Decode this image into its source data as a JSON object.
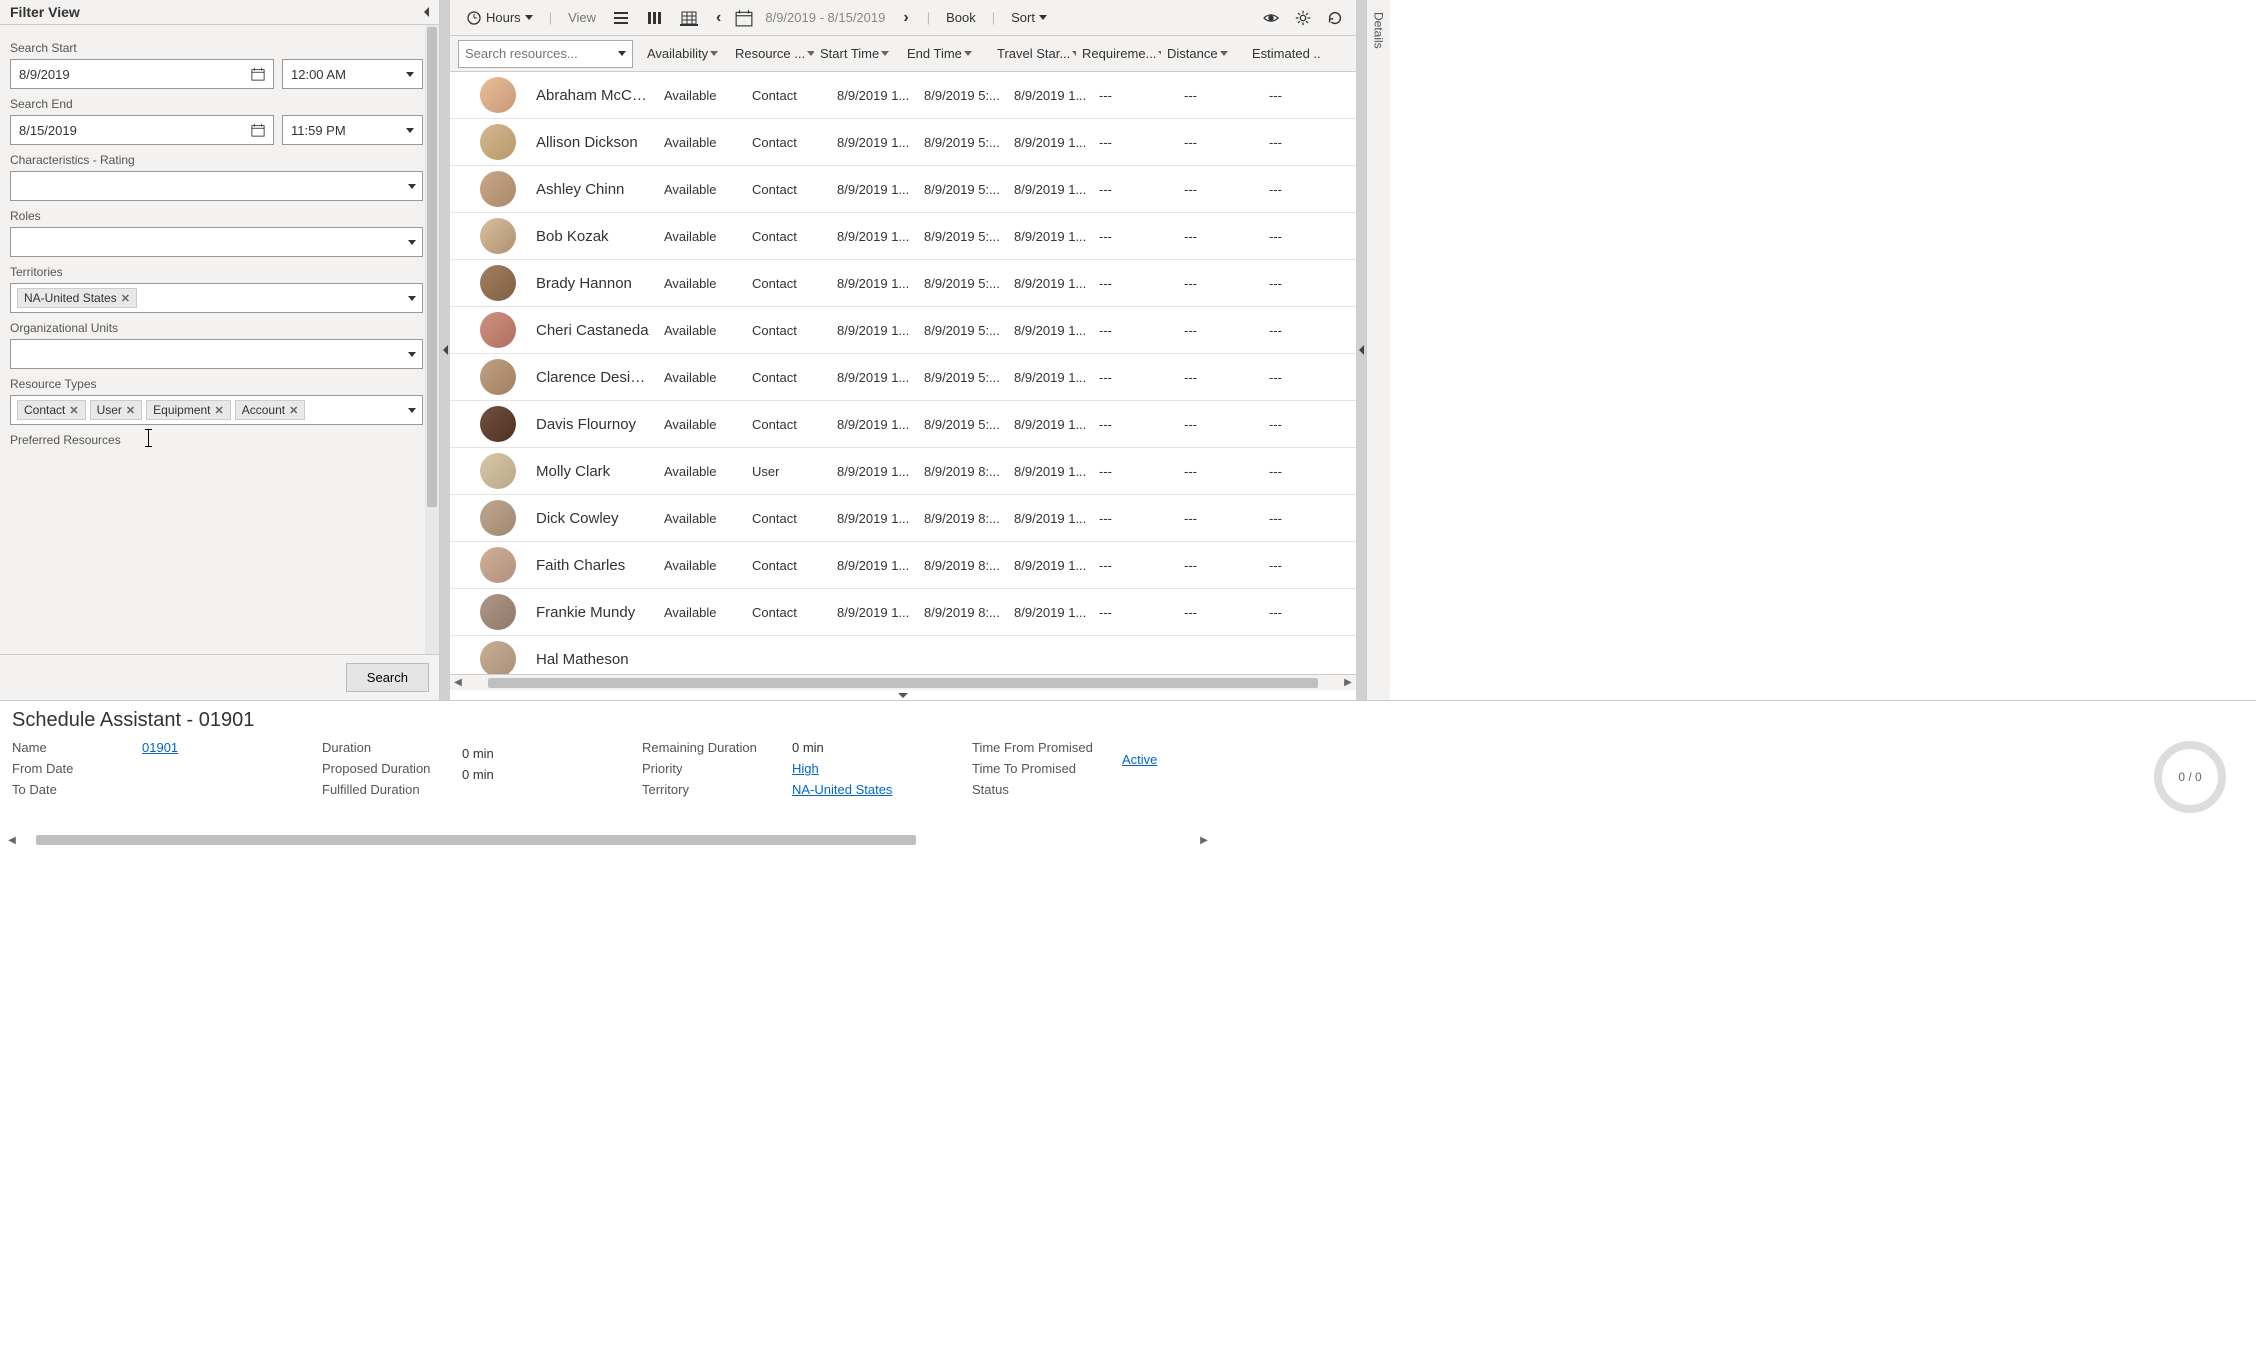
{
  "filter": {
    "title": "Filter View",
    "searchStartLabel": "Search Start",
    "searchStartDate": "8/9/2019",
    "searchStartTime": "12:00 AM",
    "searchEndLabel": "Search End",
    "searchEndDate": "8/15/2019",
    "searchEndTime": "11:59 PM",
    "characteristicsLabel": "Characteristics - Rating",
    "rolesLabel": "Roles",
    "territoriesLabel": "Territories",
    "territories": [
      "NA-United States"
    ],
    "orgUnitsLabel": "Organizational Units",
    "resourceTypesLabel": "Resource Types",
    "resourceTypes": [
      "Contact",
      "User",
      "Equipment",
      "Account"
    ],
    "preferredLabel": "Preferred Resources",
    "searchButton": "Search"
  },
  "toolbar": {
    "hoursLabel": "Hours",
    "viewLabel": "View",
    "dateRange": "8/9/2019 - 8/15/2019",
    "bookLabel": "Book",
    "sortLabel": "Sort"
  },
  "grid": {
    "searchPlaceholder": "Search resources...",
    "columns": [
      "Availability",
      "Resource ...",
      "Start Time",
      "End Time",
      "Travel Star...",
      "Requireme...",
      "Distance",
      "Estimated ..."
    ],
    "rows": [
      {
        "name": "Abraham McCor...",
        "avail": "Available",
        "res": "Contact",
        "start": "8/9/2019 1...",
        "end": "8/9/2019 5:...",
        "trav": "8/9/2019 1...",
        "req": "---",
        "dist": "---",
        "est": "---"
      },
      {
        "name": "Allison Dickson",
        "avail": "Available",
        "res": "Contact",
        "start": "8/9/2019 1...",
        "end": "8/9/2019 5:...",
        "trav": "8/9/2019 1...",
        "req": "---",
        "dist": "---",
        "est": "---"
      },
      {
        "name": "Ashley Chinn",
        "avail": "Available",
        "res": "Contact",
        "start": "8/9/2019 1...",
        "end": "8/9/2019 5:...",
        "trav": "8/9/2019 1...",
        "req": "---",
        "dist": "---",
        "est": "---"
      },
      {
        "name": "Bob Kozak",
        "avail": "Available",
        "res": "Contact",
        "start": "8/9/2019 1...",
        "end": "8/9/2019 5:...",
        "trav": "8/9/2019 1...",
        "req": "---",
        "dist": "---",
        "est": "---"
      },
      {
        "name": "Brady Hannon",
        "avail": "Available",
        "res": "Contact",
        "start": "8/9/2019 1...",
        "end": "8/9/2019 5:...",
        "trav": "8/9/2019 1...",
        "req": "---",
        "dist": "---",
        "est": "---"
      },
      {
        "name": "Cheri Castaneda",
        "avail": "Available",
        "res": "Contact",
        "start": "8/9/2019 1...",
        "end": "8/9/2019 5:...",
        "trav": "8/9/2019 1...",
        "req": "---",
        "dist": "---",
        "est": "---"
      },
      {
        "name": "Clarence Desimo...",
        "avail": "Available",
        "res": "Contact",
        "start": "8/9/2019 1...",
        "end": "8/9/2019 5:...",
        "trav": "8/9/2019 1...",
        "req": "---",
        "dist": "---",
        "est": "---"
      },
      {
        "name": "Davis Flournoy",
        "avail": "Available",
        "res": "Contact",
        "start": "8/9/2019 1...",
        "end": "8/9/2019 5:...",
        "trav": "8/9/2019 1...",
        "req": "---",
        "dist": "---",
        "est": "---"
      },
      {
        "name": "Molly Clark",
        "avail": "Available",
        "res": "User",
        "start": "8/9/2019 1...",
        "end": "8/9/2019 8:...",
        "trav": "8/9/2019 1...",
        "req": "---",
        "dist": "---",
        "est": "---"
      },
      {
        "name": "Dick Cowley",
        "avail": "Available",
        "res": "Contact",
        "start": "8/9/2019 1...",
        "end": "8/9/2019 8:...",
        "trav": "8/9/2019 1...",
        "req": "---",
        "dist": "---",
        "est": "---"
      },
      {
        "name": "Faith Charles",
        "avail": "Available",
        "res": "Contact",
        "start": "8/9/2019 1...",
        "end": "8/9/2019 8:...",
        "trav": "8/9/2019 1...",
        "req": "---",
        "dist": "---",
        "est": "---"
      },
      {
        "name": "Frankie Mundy",
        "avail": "Available",
        "res": "Contact",
        "start": "8/9/2019 1...",
        "end": "8/9/2019 8:...",
        "trav": "8/9/2019 1...",
        "req": "---",
        "dist": "---",
        "est": "---"
      },
      {
        "name": "Hal Matheson",
        "avail": "",
        "res": "",
        "start": "",
        "end": "",
        "trav": "",
        "req": "",
        "dist": "",
        "est": ""
      }
    ]
  },
  "details": {
    "label": "Details"
  },
  "bottom": {
    "title": "Schedule Assistant - 01901",
    "nameLabel": "Name",
    "nameValue": "01901",
    "fromLabel": "From Date",
    "fromValue": "",
    "toLabel": "To Date",
    "toValue": "",
    "durationLabel": "Duration",
    "durationValue": "",
    "proposedLabel": "Proposed Duration",
    "proposedValue": "0 min",
    "fulfilledLabel": "Fulfilled Duration",
    "fulfilledValue": "0 min",
    "remainingLabel": "Remaining Duration",
    "remainingValue": "0 min",
    "priorityLabel": "Priority",
    "priorityValue": "High",
    "territoryLabel": "Territory",
    "territoryValue": "NA-United States",
    "timeFromLabel": "Time From Promised",
    "timeFromValue": "",
    "timeToLabel": "Time To Promised",
    "timeToValue": "",
    "statusLabel": "Status",
    "statusValue": "Active",
    "ringText": "0 / 0"
  }
}
